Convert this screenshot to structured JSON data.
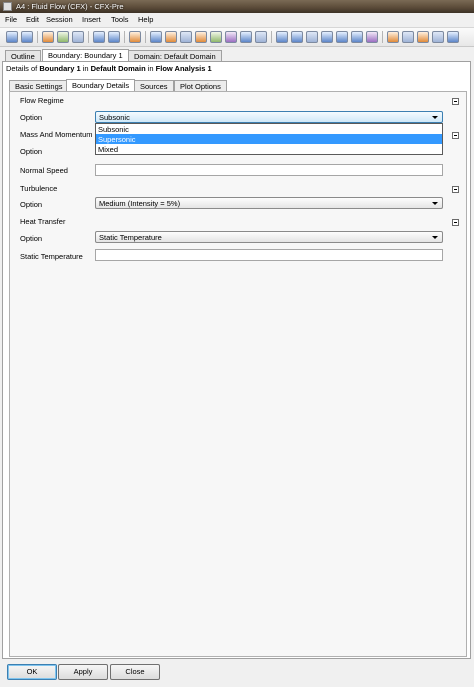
{
  "window": {
    "title": "A4 : Fluid Flow (CFX) - CFX-Pre"
  },
  "menu": [
    "File",
    "Edit",
    "Session",
    "Insert",
    "Tools",
    "Help"
  ],
  "outer_tabs": [
    "Outline",
    "Boundary: Boundary 1",
    "Domain: Default Domain"
  ],
  "details": {
    "prefix": "Details of ",
    "boundary": "Boundary 1",
    "mid1": " in ",
    "domain": "Default Domain",
    "mid2": " in ",
    "analysis": "Flow Analysis 1"
  },
  "inner_tabs": [
    "Basic Settings",
    "Boundary Details",
    "Sources",
    "Plot Options"
  ],
  "flow_regime": {
    "title": "Flow Regime",
    "option_label": "Option",
    "value": "Subsonic",
    "options": [
      "Subsonic",
      "Supersonic",
      "Mixed"
    ]
  },
  "mass_momentum": {
    "title": "Mass And Momentum",
    "option_label": "Option",
    "normal_speed_label": "Normal Speed"
  },
  "turbulence": {
    "title": "Turbulence",
    "option_label": "Option",
    "value": "Medium (Intensity = 5%)"
  },
  "heat_transfer": {
    "title": "Heat Transfer",
    "option_label": "Option",
    "value": "Static Temperature",
    "static_temp_label": "Static Temperature"
  },
  "buttons": {
    "ok": "OK",
    "apply": "Apply",
    "close": "Close"
  },
  "colors": {
    "selection": "#3399ff",
    "title_bar": "#5a4a38"
  },
  "toolbar_icons": [
    "save-icon",
    "save-as-icon",
    "import-icon",
    "report-icon",
    "undo-icon",
    "redo-icon",
    "open-icon",
    "domain-icon",
    "boundary-icon",
    "subdomain-icon",
    "source-point-icon",
    "interface-icon",
    "flask-icon",
    "expression-icon",
    "material-icon",
    "reaction-icon",
    "settings-icon",
    "function-icon",
    "rotate-icon",
    "region-icon",
    "mesh-icon",
    "volume-icon",
    "surface-icon",
    "vector-icon",
    "chart-icon",
    "compare-icon",
    "layout-icon"
  ]
}
